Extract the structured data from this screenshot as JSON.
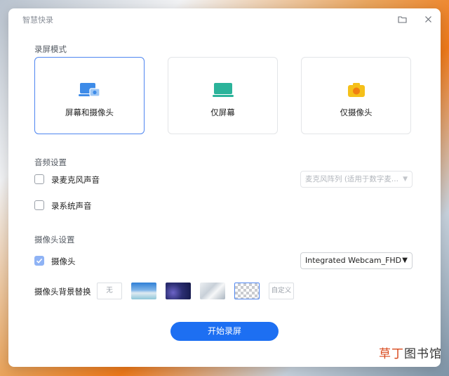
{
  "app": {
    "title": "智慧快录"
  },
  "titlebar": {
    "folder_icon": "folder-icon",
    "close_icon": "close-icon"
  },
  "record_mode": {
    "label": "录屏模式",
    "options": [
      {
        "label": "屏幕和摄像头",
        "icon": "screen-camera-icon",
        "selected": true
      },
      {
        "label": "仅屏幕",
        "icon": "monitor-icon",
        "selected": false
      },
      {
        "label": "仅摄像头",
        "icon": "camera-icon",
        "selected": false
      }
    ]
  },
  "audio": {
    "label": "音频设置",
    "microphone": {
      "label": "录麦克风声音",
      "checked": false
    },
    "mic_select": {
      "value": "麦克风阵列 (适用于数字麦..."
    },
    "system": {
      "label": "录系统声音",
      "checked": false
    }
  },
  "camera": {
    "label": "摄像头设置",
    "enabled": {
      "label": "摄像头",
      "checked": true
    },
    "device_select": {
      "value": "Integrated Webcam_FHD"
    },
    "background_label": "摄像头背景替换",
    "background_options": {
      "none": "无",
      "custom": "自定义"
    }
  },
  "start_button": {
    "label": "开始录屏"
  },
  "watermark": {
    "part1": "草丁",
    "part2": "图书馆"
  },
  "colors": {
    "accent": "#1d6ff2",
    "selected_border": "#4f86f0",
    "green_icon": "#2bb39a",
    "yellow_icon": "#f5c01a",
    "blue_icon": "#3d8be8"
  }
}
